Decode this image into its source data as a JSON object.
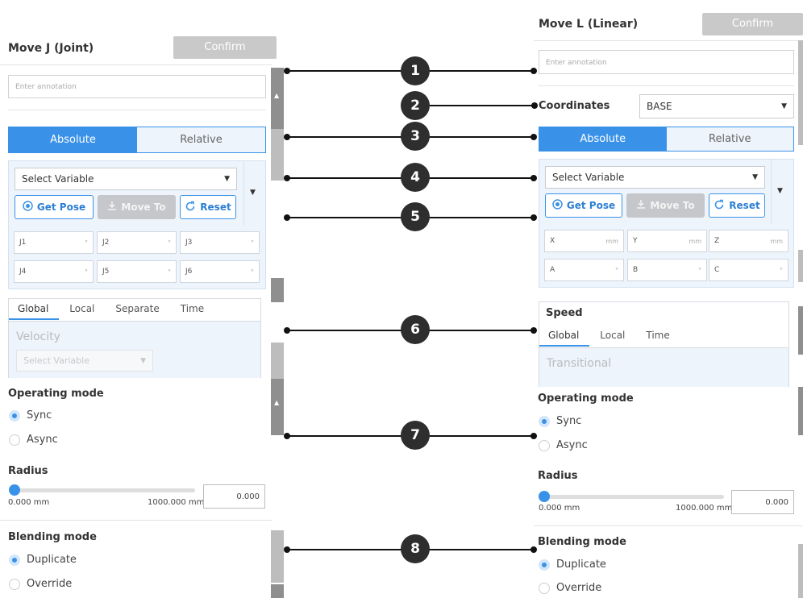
{
  "left": {
    "title": "Move J (Joint)",
    "confirm": "Confirm",
    "annotation_placeholder": "Enter annotation",
    "mode": {
      "active": "Absolute",
      "inactive": "Relative"
    },
    "select_variable": "Select Variable",
    "buttons": {
      "get_pose": "Get Pose",
      "move_to": "Move To",
      "reset": "Reset"
    },
    "joints": [
      {
        "label": "J1",
        "unit": "°"
      },
      {
        "label": "J2",
        "unit": "°"
      },
      {
        "label": "J3",
        "unit": "°"
      },
      {
        "label": "J4",
        "unit": "°"
      },
      {
        "label": "J5",
        "unit": "°"
      },
      {
        "label": "J6",
        "unit": "°"
      }
    ],
    "speed_tabs": [
      "Global",
      "Local",
      "Separate",
      "Time"
    ],
    "velocity_label": "Velocity",
    "velocity_select": "Select Variable",
    "operating_mode": {
      "heading": "Operating mode",
      "options": [
        "Sync",
        "Async"
      ],
      "selected": "Sync"
    },
    "radius": {
      "heading": "Radius",
      "min": "0.000 mm",
      "max": "1000.000 mm",
      "value": "0.000",
      "fraction": 0
    },
    "blending_mode": {
      "heading": "Blending mode",
      "options": [
        "Duplicate",
        "Override"
      ],
      "selected": "Duplicate"
    }
  },
  "right": {
    "title": "Move L (Linear)",
    "confirm": "Confirm",
    "annotation_placeholder": "Enter annotation",
    "coordinates_label": "Coordinates",
    "coordinates_value": "BASE",
    "mode": {
      "active": "Absolute",
      "inactive": "Relative"
    },
    "select_variable": "Select Variable",
    "buttons": {
      "get_pose": "Get Pose",
      "move_to": "Move To",
      "reset": "Reset"
    },
    "axes": [
      {
        "label": "X",
        "unit": "mm"
      },
      {
        "label": "Y",
        "unit": "mm"
      },
      {
        "label": "Z",
        "unit": "mm"
      },
      {
        "label": "A",
        "unit": "°"
      },
      {
        "label": "B",
        "unit": "°"
      },
      {
        "label": "C",
        "unit": "°"
      }
    ],
    "speed_heading": "Speed",
    "speed_tabs": [
      "Global",
      "Local",
      "Time"
    ],
    "transitional_label": "Transitional",
    "operating_mode": {
      "heading": "Operating mode",
      "options": [
        "Sync",
        "Async"
      ],
      "selected": "Sync"
    },
    "radius": {
      "heading": "Radius",
      "min": "0.000 mm",
      "max": "1000.000 mm",
      "value": "0.000",
      "fraction": 0
    },
    "blending_mode": {
      "heading": "Blending mode",
      "options": [
        "Duplicate",
        "Override"
      ],
      "selected": "Duplicate"
    }
  },
  "callouts": [
    "1",
    "2",
    "3",
    "4",
    "5",
    "6",
    "7",
    "8"
  ],
  "colors": {
    "accent": "#3a92e8",
    "badge": "#2e2e2e",
    "confirm": "#c9c9c9"
  },
  "icons": {
    "get_pose": "target-icon",
    "move_to": "download-icon",
    "reset": "refresh-icon"
  }
}
